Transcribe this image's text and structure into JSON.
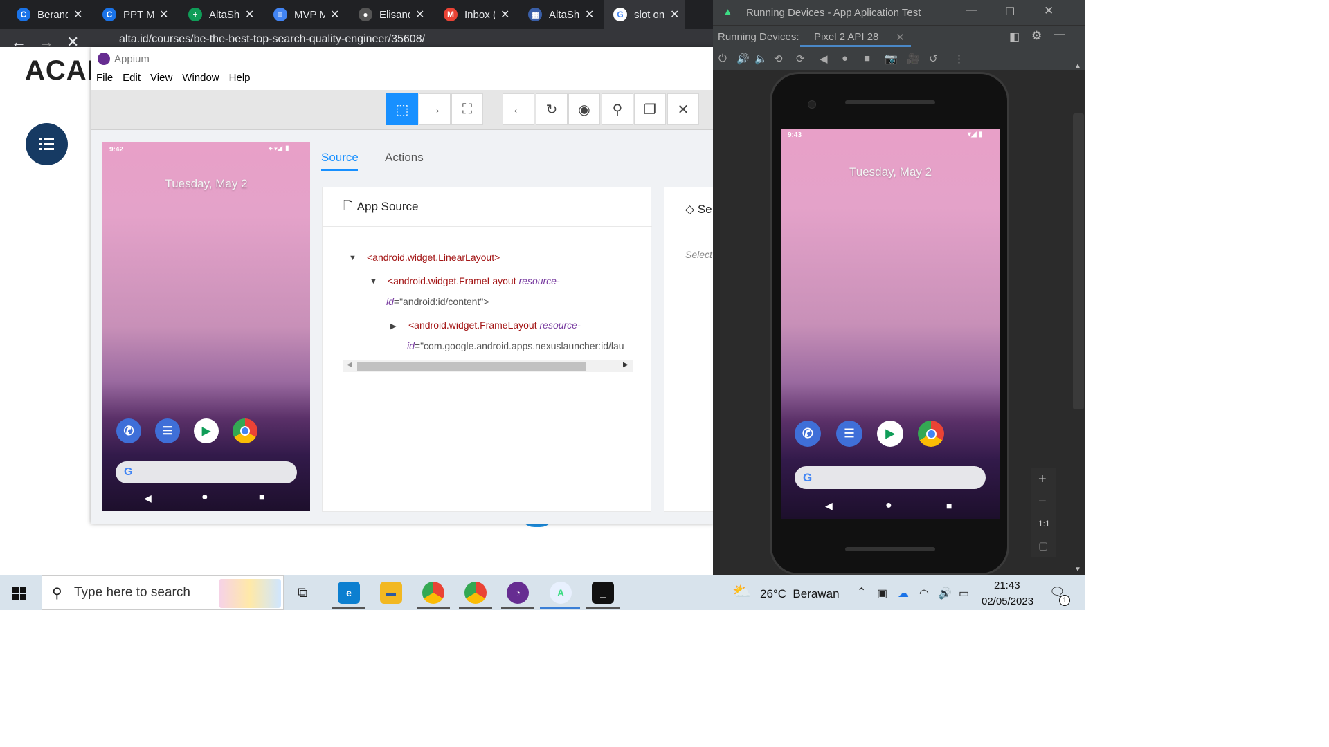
{
  "browser": {
    "tabs": [
      {
        "label": "Berand",
        "icon": "C",
        "color": "#1a73e8"
      },
      {
        "label": "PPT Mi",
        "icon": "C",
        "color": "#1a73e8"
      },
      {
        "label": "AltaSh",
        "icon": "+",
        "color": "#0f9d58"
      },
      {
        "label": "MVP M",
        "icon": "≡",
        "color": "#4285f4"
      },
      {
        "label": "Elisand",
        "icon": "●",
        "color": "#555555"
      },
      {
        "label": "Inbox (",
        "icon": "M",
        "color": "#ea4335"
      },
      {
        "label": "AltaSh",
        "icon": "▦",
        "color": "#3a5fa8"
      },
      {
        "label": "slot on",
        "icon": "G",
        "color": "#ffffff"
      }
    ],
    "url": "alta.id/courses/be-the-best-top-search-quality-engineer/35608/"
  },
  "page": {
    "brand": "ACAD"
  },
  "appium": {
    "title": "Appium",
    "menu": [
      "File",
      "Edit",
      "View",
      "Window",
      "Help"
    ],
    "tabs": {
      "source": "Source",
      "actions": "Actions"
    },
    "app_source_title": "App Source",
    "selected_title": "Se",
    "selected_placeholder": "Select",
    "tree": [
      {
        "tag": "<android.widget.LinearLayout>"
      },
      {
        "tag": "<android.widget.FrameLayout",
        "attr": "resource-",
        "attr2": "id",
        "value": "=\"android:id/content\">"
      },
      {
        "tag": "<android.widget.FrameLayout",
        "attr": "resource-",
        "attr2": "id",
        "value": "=\"com.google.android.apps.nexuslauncher:id/lau"
      }
    ]
  },
  "phone_small": {
    "time": "9:42",
    "date": "Tuesday, May 2"
  },
  "running_devices": {
    "title": "Running Devices - App Aplication Test",
    "label": "Running Devices:",
    "device_tab": "Pixel 2 API 28",
    "zoom_label": "1:1"
  },
  "phone_large": {
    "time": "9:43",
    "date": "Tuesday, May 2"
  },
  "taskbar": {
    "search_placeholder": "Type here to search",
    "weather": "26°C  Berawan",
    "time": "21:43",
    "date": "02/05/2023",
    "notif_count": "1"
  }
}
